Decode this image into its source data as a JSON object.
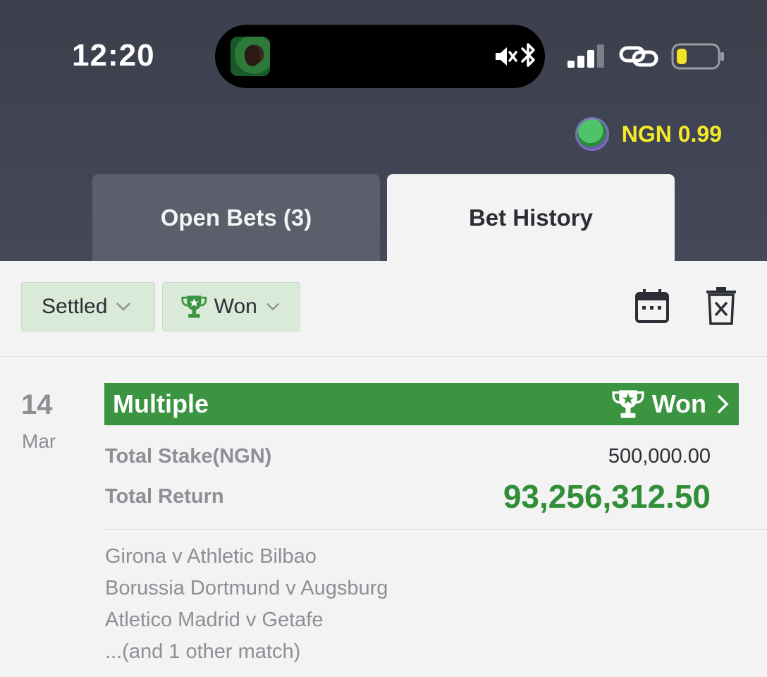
{
  "status_bar": {
    "time": "12:20",
    "bluetooth_glyph": "✱"
  },
  "header": {
    "wallet_amount": "NGN 0.99",
    "wallet_icon": "football-icon"
  },
  "tabs": [
    {
      "label": "Open Bets (3)",
      "active": false
    },
    {
      "label": "Bet History",
      "active": true
    }
  ],
  "filters": {
    "status_label": "Settled",
    "result_label": "Won",
    "icons": [
      "calendar-icon",
      "delete-icon"
    ]
  },
  "bet": {
    "day": "14",
    "month": "Mar",
    "type": "Multiple",
    "status": "Won",
    "stake_label": "Total Stake(NGN)",
    "stake_value": "500,000.00",
    "return_label": "Total Return",
    "return_value": "93,256,312.50",
    "matches": [
      "Girona v Athletic Bilbao",
      "Borussia Dortmund v Augsburg",
      "Atletico Madrid v Getafe",
      "...(and 1 other match)"
    ]
  },
  "colors": {
    "header_bg": "#3c3f4c",
    "accent_green": "#3a9440",
    "wallet_yellow": "#f5ea2a",
    "chip_bg": "#d9ead9"
  }
}
